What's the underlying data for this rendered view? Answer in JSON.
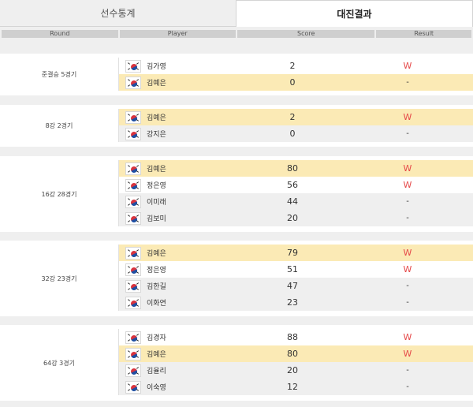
{
  "tabs": [
    {
      "label": "선수통계",
      "active": false
    },
    {
      "label": "대진결과",
      "active": true
    }
  ],
  "columns": {
    "round": "Round",
    "player": "Player",
    "score": "Score",
    "result": "Result"
  },
  "colors": {
    "highlight": "#fbeab5",
    "win": "#e54848",
    "alt_row": "#efefef"
  },
  "matches": [
    {
      "round": "준결승 5경기",
      "players": [
        {
          "name": "김가영",
          "score": "2",
          "result": "W",
          "highlight": false
        },
        {
          "name": "김예은",
          "score": "0",
          "result": "-",
          "highlight": true
        }
      ]
    },
    {
      "round": "8강 2경기",
      "players": [
        {
          "name": "김예은",
          "score": "2",
          "result": "W",
          "highlight": true
        },
        {
          "name": "강지은",
          "score": "0",
          "result": "-",
          "highlight": false
        }
      ]
    },
    {
      "round": "16강 28경기",
      "players": [
        {
          "name": "김예은",
          "score": "80",
          "result": "W",
          "highlight": true
        },
        {
          "name": "정은영",
          "score": "56",
          "result": "W",
          "highlight": false
        },
        {
          "name": "이미래",
          "score": "44",
          "result": "-",
          "highlight": false
        },
        {
          "name": "김보미",
          "score": "20",
          "result": "-",
          "highlight": false
        }
      ]
    },
    {
      "round": "32강 23경기",
      "players": [
        {
          "name": "김예은",
          "score": "79",
          "result": "W",
          "highlight": true
        },
        {
          "name": "정은영",
          "score": "51",
          "result": "W",
          "highlight": false
        },
        {
          "name": "김한길",
          "score": "47",
          "result": "-",
          "highlight": false
        },
        {
          "name": "이화연",
          "score": "23",
          "result": "-",
          "highlight": false
        }
      ]
    },
    {
      "round": "64강 3경기",
      "players": [
        {
          "name": "김경자",
          "score": "88",
          "result": "W",
          "highlight": false
        },
        {
          "name": "김예은",
          "score": "80",
          "result": "W",
          "highlight": true
        },
        {
          "name": "김율리",
          "score": "20",
          "result": "-",
          "highlight": false
        },
        {
          "name": "이숙영",
          "score": "12",
          "result": "-",
          "highlight": false
        }
      ]
    }
  ]
}
